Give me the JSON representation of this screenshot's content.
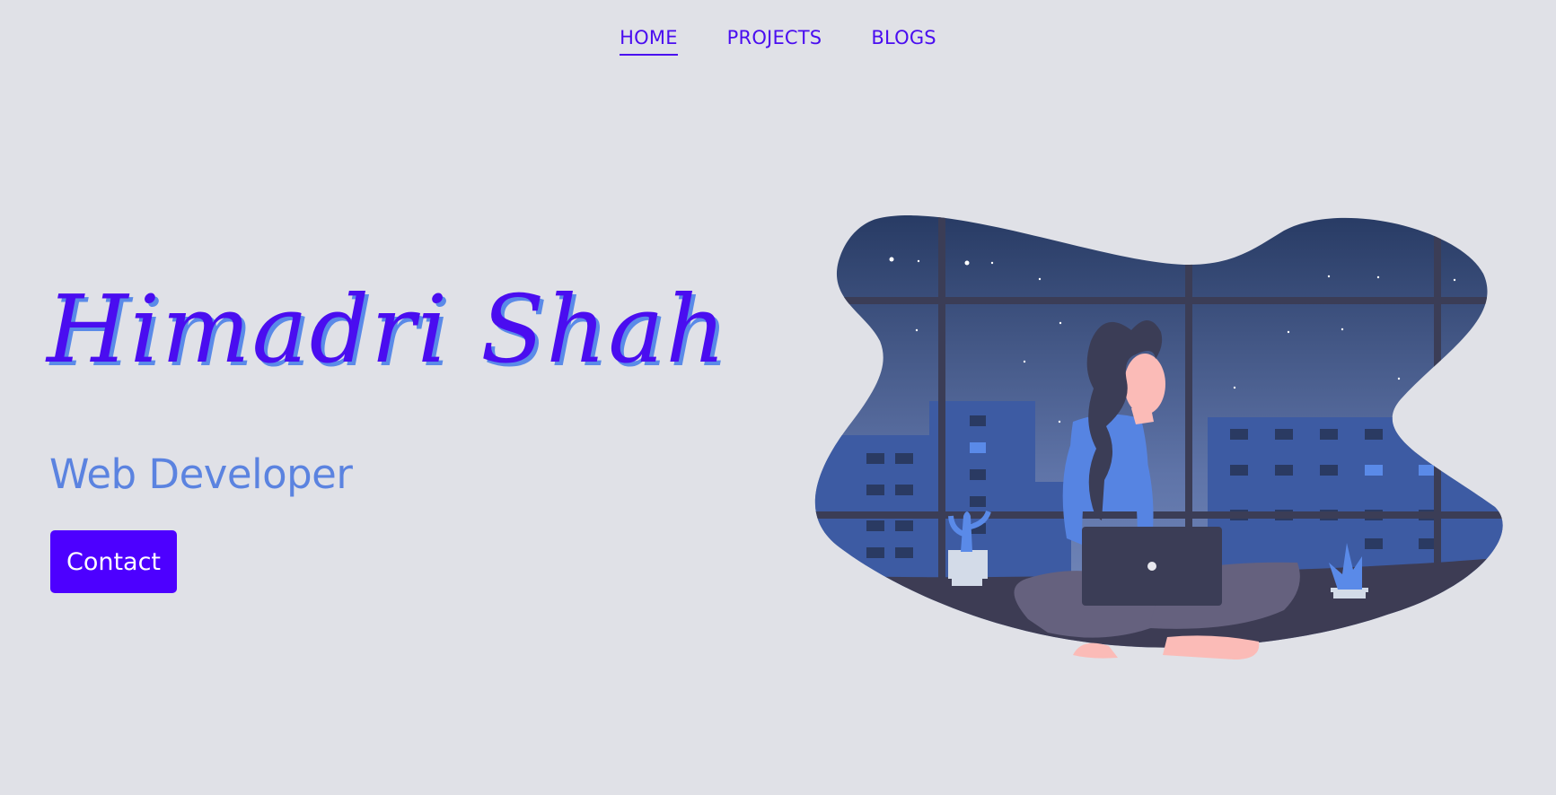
{
  "nav": {
    "items": [
      {
        "label": "HOME",
        "active": true
      },
      {
        "label": "PROJECTS",
        "active": false
      },
      {
        "label": "BLOGS",
        "active": false
      }
    ]
  },
  "hero": {
    "name": "Himadri Shah",
    "role": "Web Developer",
    "contact_label": "Contact"
  },
  "colors": {
    "background": "#e0e1e7",
    "accent": "#4d00ff",
    "role_text": "#5b83e0"
  },
  "illustration": {
    "icon": "woman-with-laptop-night-city-illustration"
  }
}
